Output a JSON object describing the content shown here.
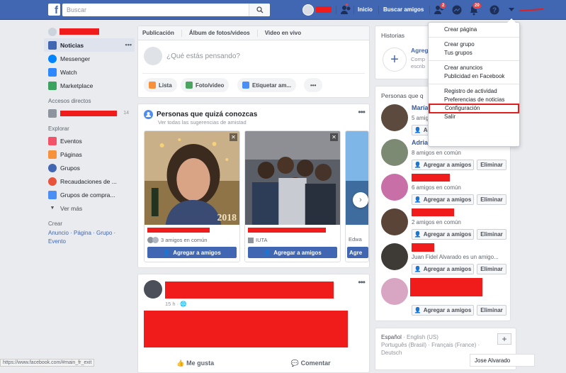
{
  "header": {
    "logo": "f",
    "search_placeholder": "Buscar",
    "nav_home": "Inicio",
    "nav_find_friends": "Buscar amigos",
    "friend_badge": "2",
    "notif_badge": "20"
  },
  "sidebar": {
    "items": [
      {
        "label": "Noticias"
      },
      {
        "label": "Messenger"
      },
      {
        "label": "Watch"
      },
      {
        "label": "Marketplace"
      }
    ],
    "shortcuts_header": "Accesos directos",
    "shortcut_count": "14",
    "explore_header": "Explorar",
    "explore_items": [
      {
        "label": "Eventos"
      },
      {
        "label": "Páginas"
      },
      {
        "label": "Grupos"
      },
      {
        "label": "Recaudaciones de ..."
      },
      {
        "label": "Grupos de compra..."
      }
    ],
    "see_more": "Ver más",
    "create_header": "Crear",
    "create_links": "Anuncio · Página · Grupo · Evento"
  },
  "composer": {
    "tab_post": "Publicación",
    "tab_album": "Álbum de fotos/videos",
    "tab_live": "Video en vivo",
    "placeholder": "¿Qué estás pensando?",
    "btn_list": "Lista",
    "btn_photo": "Foto/video",
    "btn_tag": "Etiquetar am...",
    "btn_more": "•••"
  },
  "pymk": {
    "title": "Personas que quizá conozcas",
    "subtitle": "Ver todas las sugerencias de amistad",
    "cards": [
      {
        "mutual": "3 amigos en común",
        "action": "Agregar a amigos",
        "tag": ""
      },
      {
        "mutual": "",
        "action": "Agregar a amigos",
        "tag": "IUTA"
      },
      {
        "mutual": "Edwa",
        "action": "Agre",
        "tag": ""
      }
    ]
  },
  "post": {
    "time": "15 h · ",
    "like": "Me gusta",
    "comment": "Comentar"
  },
  "right": {
    "stories_title": "Historias",
    "stories_add": "Agreg",
    "stories_sub": "Comp escrib",
    "pymk_title": "Personas que q",
    "people": [
      {
        "name": "María",
        "mutual": "5 amigos en co"
      },
      {
        "name": "Adrian",
        "mutual": "8 amigos en común"
      },
      {
        "name": "",
        "mutual": "6 amigos en común"
      },
      {
        "name": "",
        "mutual": "2 amigos en común"
      },
      {
        "name": "",
        "mutual": "Juan Fidel Alvarado es un amigo..."
      },
      {
        "name": "",
        "mutual": ""
      }
    ],
    "add_label": "Agregar a amigos",
    "delete_label": "Eliminar",
    "lang_current": "Español",
    "lang_line1": "English (US)",
    "lang_line2": "Português (Brasil) · Français (France) ·",
    "lang_line3": "Deutsch"
  },
  "menu": {
    "items": [
      "Crear página",
      "Crear grupo",
      "Tus grupos",
      "Crear anuncios",
      "Publicidad en Facebook",
      "Registro de actividad",
      "Preferencias de noticias",
      "Configuración",
      "Salir"
    ]
  },
  "status_url": "https://www.facebook.com/#main_fr_exit",
  "chat_name": "Jose Alvarado"
}
